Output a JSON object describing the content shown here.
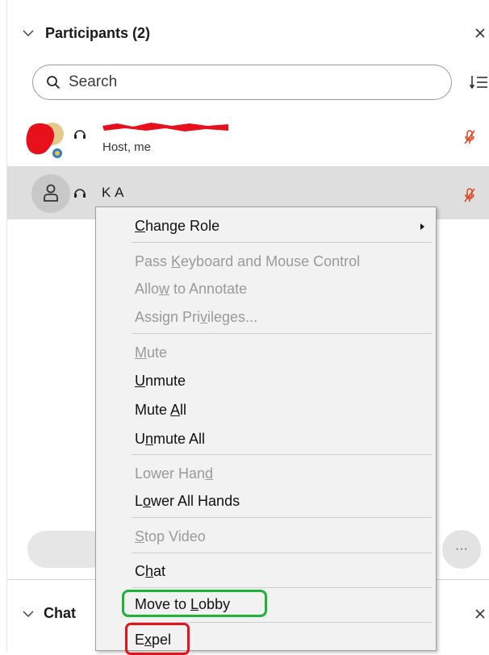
{
  "participants_panel": {
    "title": "Participants (2)",
    "search": {
      "placeholder": "Search",
      "value": ""
    },
    "participants": [
      {
        "name_redacted": true,
        "role": "Host, me",
        "audio": "headset",
        "mic": "muted"
      },
      {
        "name": "K A",
        "audio": "headset",
        "mic": "muted",
        "selected": true
      }
    ]
  },
  "context_menu": {
    "items": [
      {
        "label_pre": "",
        "accel": "C",
        "label_post": "hange Role",
        "enabled": true,
        "submenu": true
      },
      {
        "label_pre": "Pass ",
        "accel": "K",
        "label_post": "eyboard and Mouse Control",
        "enabled": false
      },
      {
        "label_pre": "Allo",
        "accel": "w",
        "label_post": " to Annotate",
        "enabled": false
      },
      {
        "label_pre": "Assign Pri",
        "accel": "v",
        "label_post": "ileges...",
        "enabled": false
      },
      {
        "label_pre": "",
        "accel": "M",
        "label_post": "ute",
        "enabled": false
      },
      {
        "label_pre": "",
        "accel": "U",
        "label_post": "nmute",
        "enabled": true
      },
      {
        "label_pre": "Mute ",
        "accel": "A",
        "label_post": "ll",
        "enabled": true
      },
      {
        "label_pre": "U",
        "accel": "n",
        "label_post": "mute All",
        "enabled": true
      },
      {
        "label_pre": "Lower Han",
        "accel": "d",
        "label_post": "",
        "enabled": false
      },
      {
        "label_pre": "L",
        "accel": "o",
        "label_post": "wer All Hands",
        "enabled": true
      },
      {
        "label_pre": "",
        "accel": "S",
        "label_post": "top Video",
        "enabled": false
      },
      {
        "label_pre": "C",
        "accel": "h",
        "label_post": "at",
        "enabled": true
      },
      {
        "label_pre": "Move to ",
        "accel": "L",
        "label_post": "obby",
        "enabled": true,
        "highlight": "green"
      },
      {
        "label_pre": "E",
        "accel": "x",
        "label_post": "pel",
        "enabled": true,
        "highlight": "red"
      }
    ]
  },
  "chat_panel": {
    "title": "Chat"
  },
  "colors": {
    "mic_muted": "#e0401a",
    "selected_row": "#dedede",
    "menu_background": "#f2f2f2",
    "highlight_green": "#1db33a",
    "highlight_red": "#e0141a",
    "redaction": "#e8101a"
  },
  "icons": [
    "chevron-down-icon",
    "close-icon",
    "search-icon",
    "sort-icon",
    "headset-icon",
    "mic-muted-icon",
    "person-icon",
    "more-icon",
    "submenu-arrow-icon"
  ]
}
